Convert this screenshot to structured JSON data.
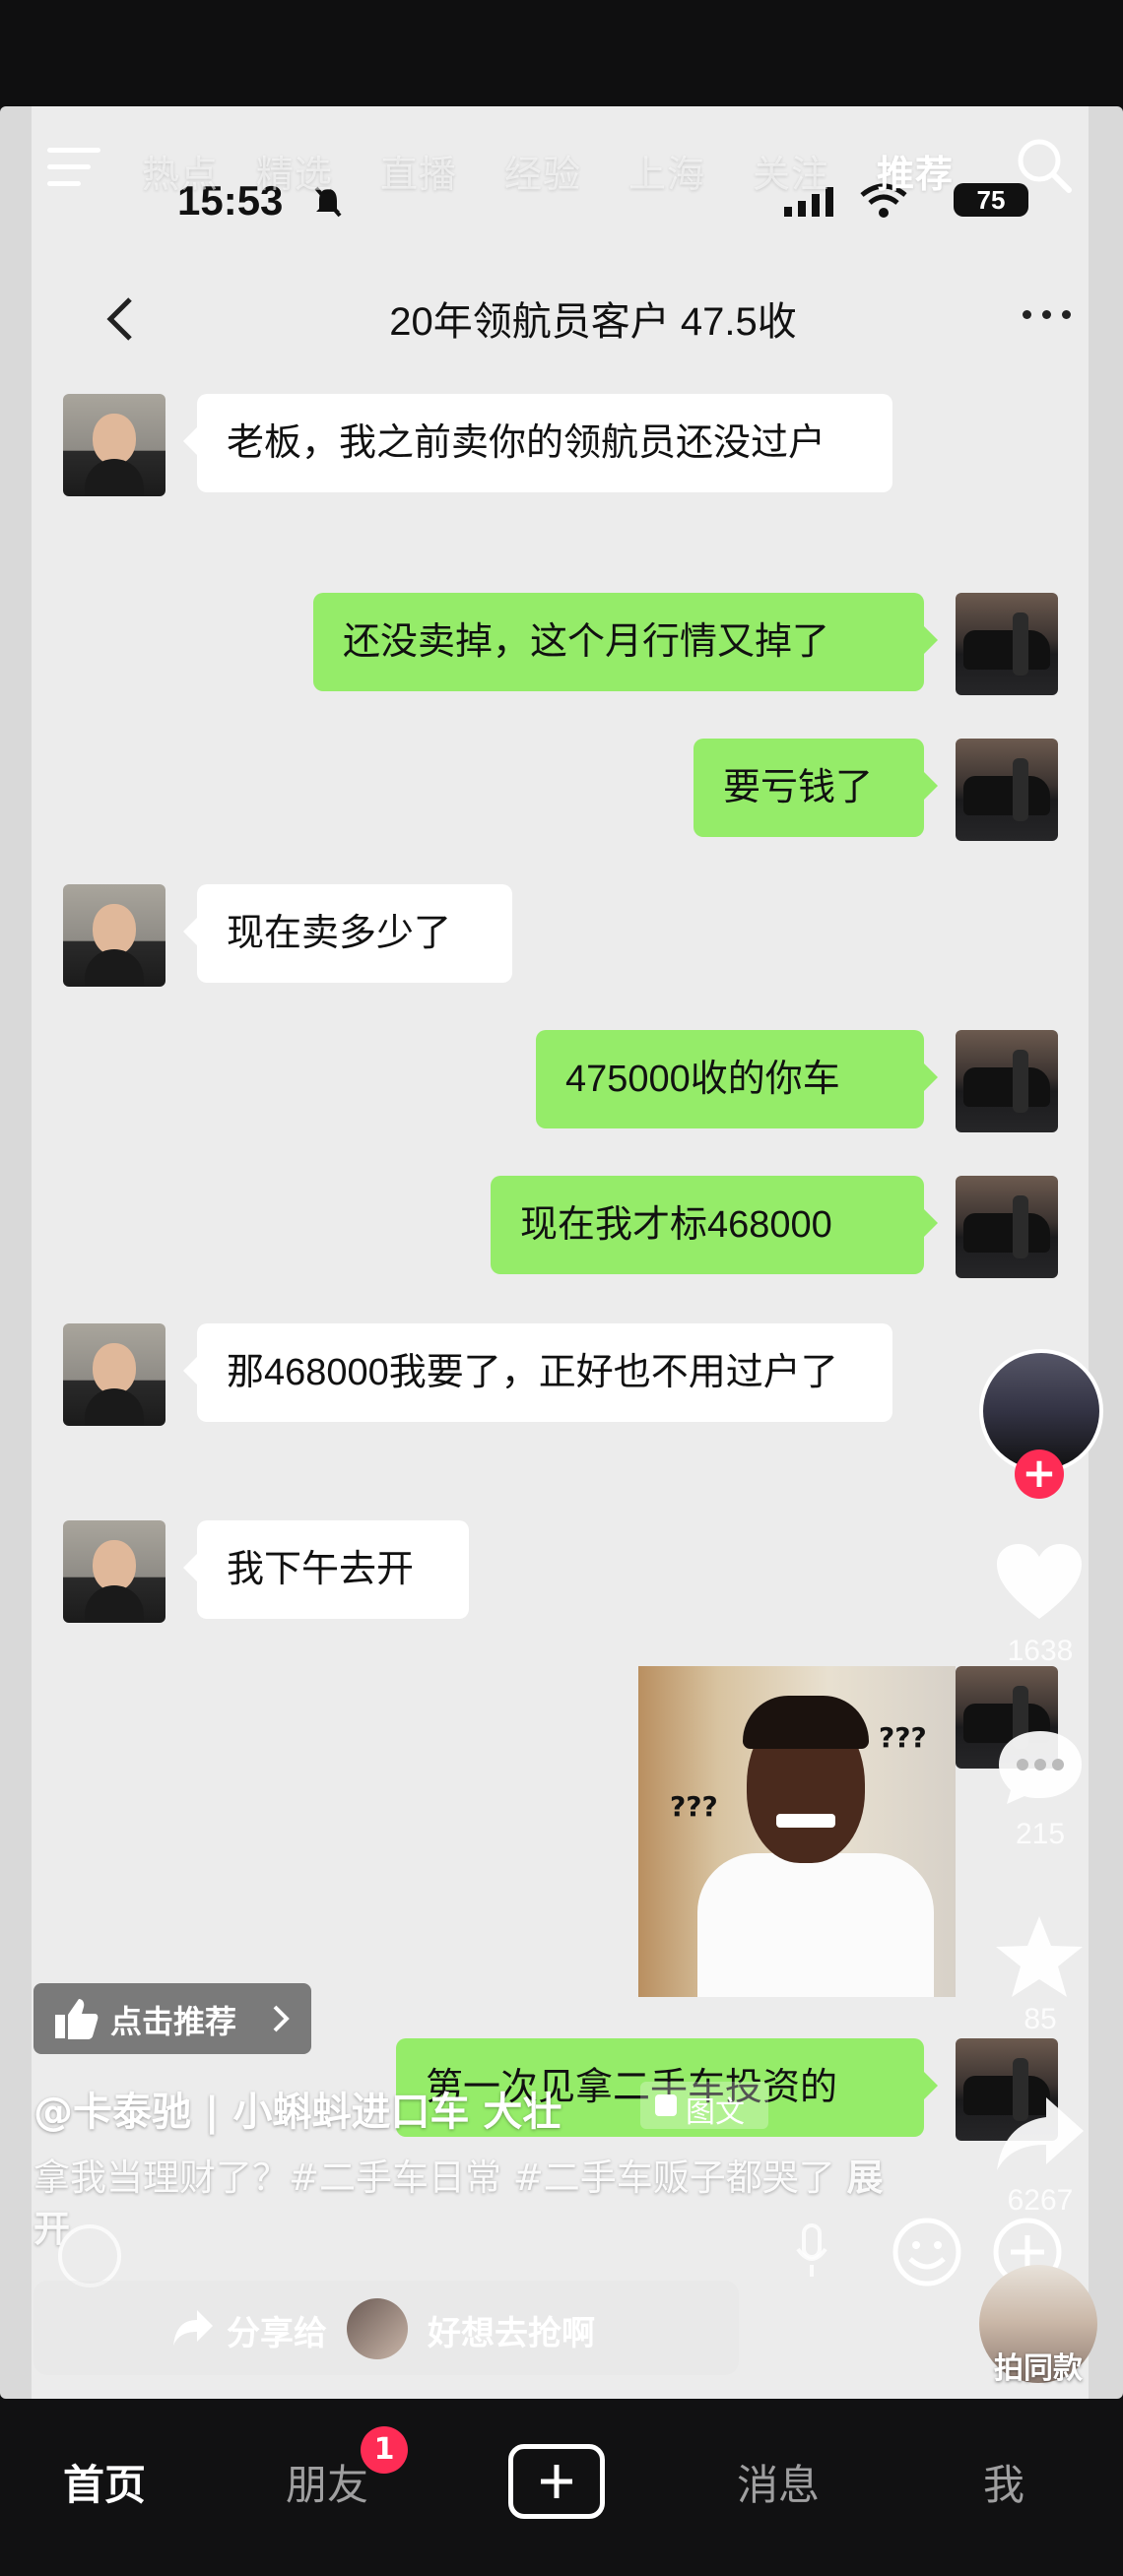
{
  "top_nav": {
    "tabs": [
      "热点",
      "精选",
      "直播",
      "经验",
      "上海",
      "关注",
      "推荐"
    ],
    "active": "推荐"
  },
  "status_bar": {
    "time": "15:53",
    "battery": "75"
  },
  "chat": {
    "title": "20年领航员客户 47.5收",
    "messages": [
      {
        "side": "left",
        "text": "老板，我之前卖你的领航员还没过户"
      },
      {
        "side": "right",
        "text": "还没卖掉，这个月行情又掉了"
      },
      {
        "side": "right",
        "text": "要亏钱了"
      },
      {
        "side": "left",
        "text": "现在卖多少了"
      },
      {
        "side": "right",
        "text": "475000收的你车"
      },
      {
        "side": "right",
        "text": "现在我才标468000"
      },
      {
        "side": "left",
        "text": "那468000我要了，正好也不用过户了"
      },
      {
        "side": "left",
        "text": "我下午去开"
      },
      {
        "side": "right",
        "type": "sticker",
        "text": "???"
      },
      {
        "side": "right",
        "text": "第一次见拿二手车投资的"
      }
    ]
  },
  "rail": {
    "likes": "1638",
    "comments": "215",
    "favorites": "85",
    "shares": "6267",
    "same_style": "拍同款"
  },
  "overlay": {
    "recommend": "点击推荐",
    "author": "@卡泰驰 | 小蝌蚪进口车 大壮",
    "tuwen": "图文",
    "caption": "拿我当理财了？#二手车日常 #二手车贩子都哭了",
    "expand": "展开",
    "share_label": "分享给",
    "share_target": "好想去抢啊"
  },
  "bottom_nav": {
    "items": [
      "首页",
      "朋友",
      "消息",
      "我"
    ],
    "badge": "1"
  },
  "colors": {
    "accent": "#fe2c55",
    "bubble_right": "#95ec69",
    "bubble_left": "#ffffff"
  }
}
